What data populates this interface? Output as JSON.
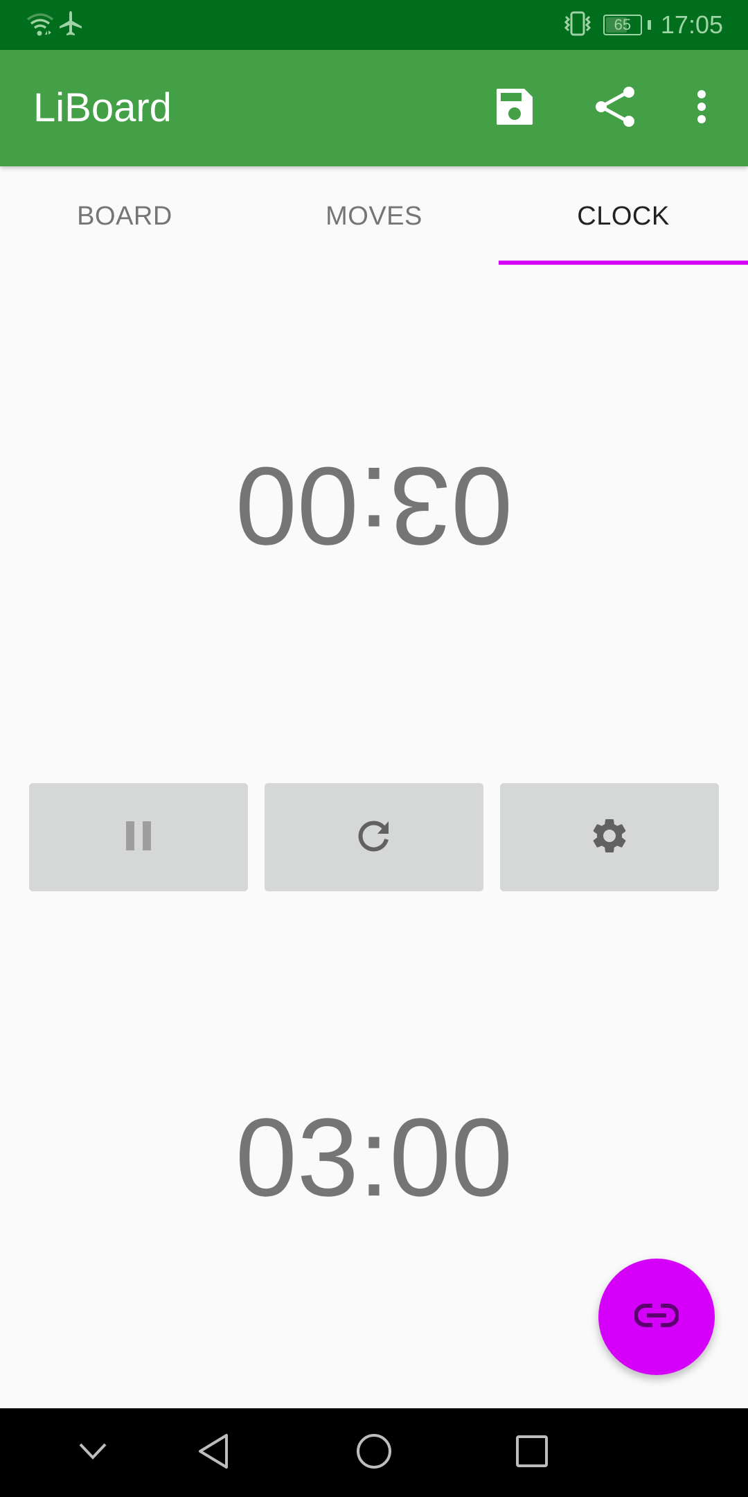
{
  "status_bar": {
    "time": "17:05",
    "battery_percent": "65",
    "battery_level": 0.65,
    "icons": [
      "wifi-icon",
      "airplane-mode-icon",
      "vibrate-icon",
      "battery-icon"
    ]
  },
  "app_bar": {
    "title": "LiBoard",
    "actions": [
      {
        "name": "save",
        "icon": "save-icon"
      },
      {
        "name": "share",
        "icon": "share-icon"
      },
      {
        "name": "more",
        "icon": "more-vert-icon"
      }
    ]
  },
  "tabs": [
    {
      "label": "BOARD",
      "active": false
    },
    {
      "label": "MOVES",
      "active": false
    },
    {
      "label": "CLOCK",
      "active": true
    }
  ],
  "clock": {
    "top_player_time": "03:00",
    "bottom_player_time": "03:00",
    "controls": [
      {
        "name": "pause",
        "icon": "pause-icon",
        "enabled": false
      },
      {
        "name": "reset",
        "icon": "refresh-icon",
        "enabled": true
      },
      {
        "name": "settings",
        "icon": "gear-icon",
        "enabled": true
      }
    ]
  },
  "fab": {
    "icon": "link-icon"
  },
  "colors": {
    "status_bar": "#006e1c",
    "app_bar": "#43a047",
    "accent": "#d500f9",
    "clock_text": "#757575",
    "button_bg": "#d6d7d7"
  },
  "nav_bar": {
    "buttons": [
      "hide-nav-icon",
      "back-icon",
      "home-icon",
      "recents-icon"
    ]
  }
}
